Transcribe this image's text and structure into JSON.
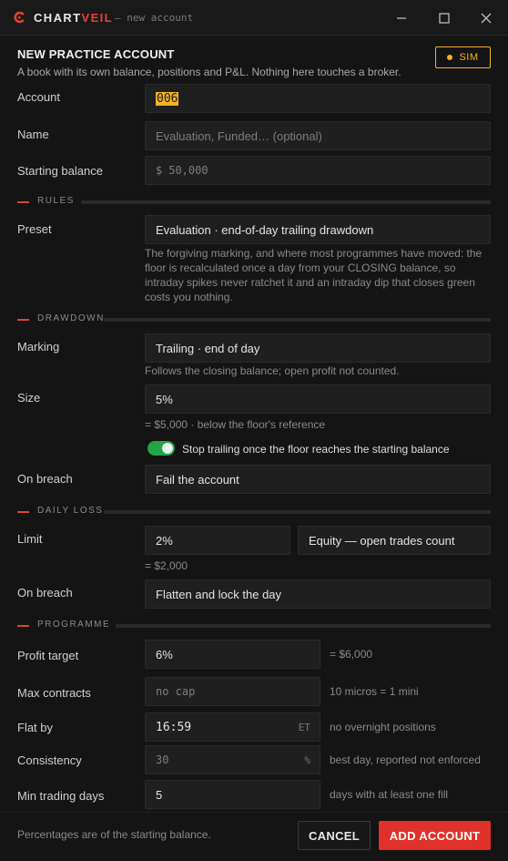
{
  "window": {
    "brand_a": "CHART",
    "brand_b": "VEIL",
    "subtitle": "— new account"
  },
  "header": {
    "title": "NEW PRACTICE ACCOUNT",
    "description": "A book with its own balance, positions and P&L. Nothing here touches a broker.",
    "badge": "SIM"
  },
  "fields": {
    "account": {
      "label": "Account",
      "value": "006"
    },
    "name": {
      "label": "Name",
      "placeholder": "Evaluation, Funded… (optional)"
    },
    "starting_balance": {
      "label": "Starting balance",
      "prefix": "$",
      "value": "50,000"
    }
  },
  "rules": {
    "section": "RULES",
    "preset_label": "Preset",
    "preset_value": "Evaluation · end-of-day trailing drawdown",
    "preset_desc": "The forgiving marking, and where most programmes have moved: the floor is recalculated once a day from your CLOSING balance, so intraday spikes never ratchet it and an intraday dip that closes green costs you nothing."
  },
  "drawdown": {
    "section": "DRAWDOWN",
    "marking_label": "Marking",
    "marking_value": "Trailing · end of day",
    "marking_hint": "Follows the closing balance; open profit not counted.",
    "size_label": "Size",
    "size_value": "5%",
    "size_hint": "= $5,000 · below the floor's reference",
    "toggle_label": "Stop trailing once the floor reaches the starting balance",
    "toggle_on": true,
    "breach_label": "On breach",
    "breach_value": "Fail the account"
  },
  "daily_loss": {
    "section": "DAILY LOSS",
    "limit_label": "Limit",
    "limit_value": "2%",
    "mode_value": "Equity — open trades count",
    "limit_hint": "= $2,000",
    "breach_label": "On breach",
    "breach_value": "Flatten and lock the day"
  },
  "programme": {
    "section": "PROGRAMME",
    "profit_label": "Profit target",
    "profit_value": "6%",
    "profit_hint": "= $6,000",
    "contracts_label": "Max contracts",
    "contracts_placeholder": "no cap",
    "contracts_hint": "10 micros = 1 mini",
    "flat_label": "Flat by",
    "flat_value": "16:59",
    "flat_suffix": "ET",
    "flat_hint": "no overnight positions",
    "consistency_label": "Consistency",
    "consistency_placeholder": "30",
    "consistency_suffix": "%",
    "consistency_hint": "best day, reported not enforced",
    "min_days_label": "Min trading days",
    "min_days_value": "5",
    "min_days_hint": "days with at least one fill"
  },
  "footer": {
    "note": "Percentages are of the starting balance.",
    "cancel": "CANCEL",
    "add": "ADD ACCOUNT"
  },
  "colors": {
    "accent": "#e34234",
    "sim": "#f4b21e",
    "toggle": "#22a447"
  }
}
